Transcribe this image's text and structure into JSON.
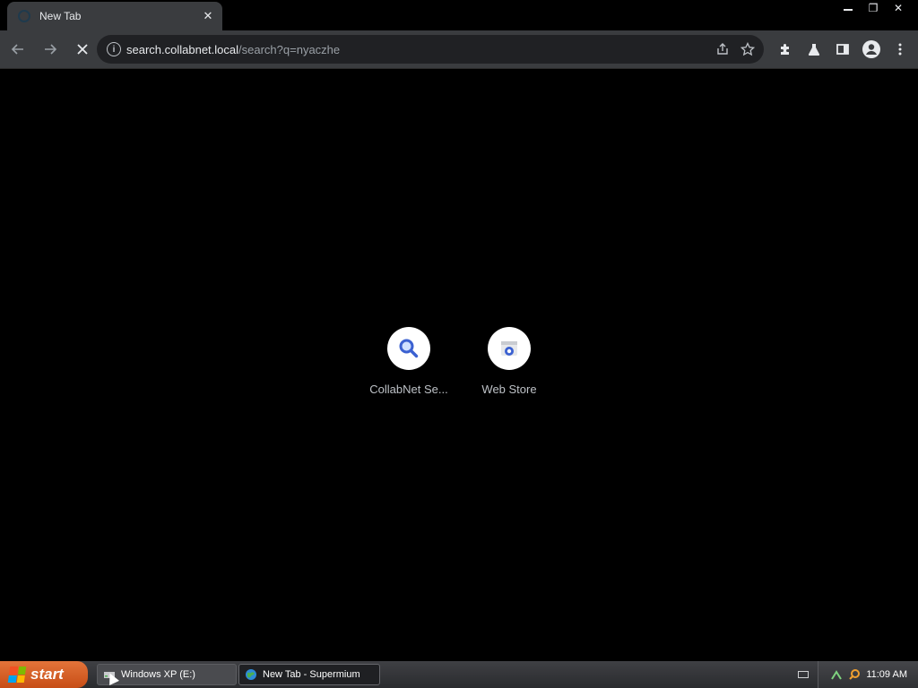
{
  "tab": {
    "title": "New Tab",
    "close_label": "✕"
  },
  "window": {
    "minimize": "",
    "restore": "❐",
    "close": "✕"
  },
  "omnibox": {
    "url_host": "search.collabnet.local",
    "url_path": "/search?q=nyaczhe"
  },
  "shortcuts": [
    {
      "label": "CollabNet Se...",
      "icon": "search-icon"
    },
    {
      "label": "Web Store",
      "icon": "web-store-icon"
    }
  ],
  "taskbar": {
    "start_label": "start",
    "tasks": [
      {
        "label": "Windows XP (E:)",
        "active": false
      },
      {
        "label": "New Tab - Supermium",
        "active": true
      }
    ],
    "clock": "11:09 AM"
  },
  "colors": {
    "accent_blue": "#3b61d1",
    "toolbar": "#3a3c3f",
    "omnibox": "#202124",
    "start": "#d4602a"
  }
}
